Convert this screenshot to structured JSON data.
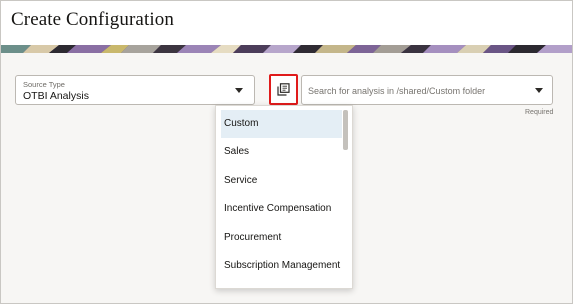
{
  "page": {
    "title": "Create Configuration"
  },
  "source_type": {
    "label": "Source Type",
    "value": "OTBI Analysis"
  },
  "browse_button": {
    "icon": "copy-icon"
  },
  "search": {
    "placeholder": "Search for analysis in /shared/Custom folder",
    "value": "",
    "required_text": "Required"
  },
  "folder_dropdown": {
    "items": [
      {
        "label": "Custom",
        "selected": true
      },
      {
        "label": "Sales",
        "selected": false
      },
      {
        "label": "Service",
        "selected": false
      },
      {
        "label": "Incentive Compensation",
        "selected": false
      },
      {
        "label": "Procurement",
        "selected": false
      },
      {
        "label": "Subscription Management",
        "selected": false
      }
    ]
  },
  "colors": {
    "accent_border": "#e01b1b",
    "selected_item_bg": "#e4eef5",
    "banner_base": "#5b4474"
  }
}
